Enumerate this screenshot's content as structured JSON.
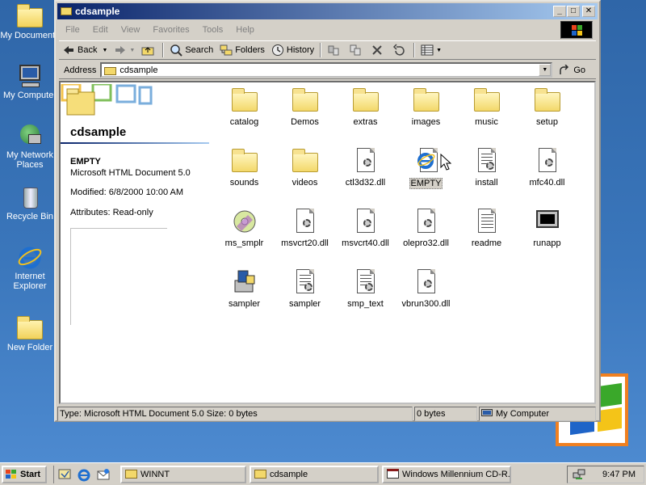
{
  "desktop": {
    "icons": [
      {
        "label": "My Documents",
        "icon": "folder-icon"
      },
      {
        "label": "My Computer",
        "icon": "computer-icon"
      },
      {
        "label": "My Network Places",
        "icon": "network-icon"
      },
      {
        "label": "Recycle Bin",
        "icon": "recycle-bin-icon"
      },
      {
        "label": "Internet Explorer",
        "icon": "ie-icon"
      },
      {
        "label": "New Folder",
        "icon": "folder-icon"
      }
    ]
  },
  "window": {
    "title": "cdsample",
    "menu": [
      "File",
      "Edit",
      "View",
      "Favorites",
      "Tools",
      "Help"
    ],
    "toolbar": {
      "back": "Back",
      "search": "Search",
      "folders": "Folders",
      "history": "History"
    },
    "address": {
      "label": "Address",
      "value": "cdsample",
      "go": "Go"
    },
    "left_pane": {
      "folder_title": "cdsample",
      "selected_name": "EMPTY",
      "selected_type": "Microsoft HTML Document 5.0",
      "modified": "Modified: 6/8/2000 10:00 AM",
      "attributes": "Attributes: Read-only"
    },
    "items": [
      {
        "label": "catalog",
        "icon": "folder"
      },
      {
        "label": "Demos",
        "icon": "folder"
      },
      {
        "label": "extras",
        "icon": "folder"
      },
      {
        "label": "images",
        "icon": "folder"
      },
      {
        "label": "music",
        "icon": "folder"
      },
      {
        "label": "setup",
        "icon": "folder"
      },
      {
        "label": "sounds",
        "icon": "folder"
      },
      {
        "label": "videos",
        "icon": "folder"
      },
      {
        "label": "ctl3d32.dll",
        "icon": "dll"
      },
      {
        "label": "EMPTY",
        "icon": "html",
        "selected": true
      },
      {
        "label": "install",
        "icon": "text-gear"
      },
      {
        "label": "mfc40.dll",
        "icon": "dll"
      },
      {
        "label": "ms_smplr",
        "icon": "cd"
      },
      {
        "label": "msvcrt20.dll",
        "icon": "dll"
      },
      {
        "label": "msvcrt40.dll",
        "icon": "dll"
      },
      {
        "label": "olepro32.dll",
        "icon": "dll"
      },
      {
        "label": "readme",
        "icon": "text"
      },
      {
        "label": "runapp",
        "icon": "monitor"
      },
      {
        "label": "sampler",
        "icon": "setup"
      },
      {
        "label": "sampler",
        "icon": "text-gear"
      },
      {
        "label": "smp_text",
        "icon": "text-gear"
      },
      {
        "label": "vbrun300.dll",
        "icon": "dll"
      }
    ],
    "status": {
      "info": "Type: Microsoft HTML Document 5.0 Size: 0 bytes",
      "size": "0 bytes",
      "zone": "My Computer"
    }
  },
  "taskbar": {
    "start": "Start",
    "tasks": [
      "WINNT",
      "cdsample",
      "Windows Millennium CD-R..."
    ],
    "clock": "9:47 PM"
  }
}
